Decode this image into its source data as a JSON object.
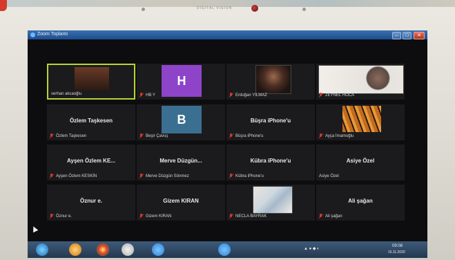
{
  "monitor": {
    "brand_text": "DIGITAL VISION"
  },
  "window": {
    "title": "Zoom Toplantı"
  },
  "tiles": [
    {
      "name": "serhan akcaoğlu",
      "center": "",
      "type": "video"
    },
    {
      "name": "HB Y",
      "center": "",
      "type": "letter",
      "letter": "H",
      "letter_color": "#8e44c8"
    },
    {
      "name": "Erdoğan YILMAZ",
      "center": "",
      "type": "video"
    },
    {
      "name": "ZEYNEL HOCA",
      "center": "",
      "type": "video"
    },
    {
      "name": "Özlem Taşkesen",
      "center": "Özlem Taşkesen",
      "type": "text"
    },
    {
      "name": "Beşir Çavuş",
      "center": "",
      "type": "letter",
      "letter": "B",
      "letter_color": "#3b6f91"
    },
    {
      "name": "Büşra iPhone'u",
      "center": "Büşra iPhone'u",
      "type": "text"
    },
    {
      "name": "Ayça İmamoğlu",
      "center": "",
      "type": "video"
    },
    {
      "name": "Ayşen Özlem KESKİN",
      "center": "Ayşen Özlem KE...",
      "type": "text"
    },
    {
      "name": "Merve Düzgün Sönmez",
      "center": "Merve Düzgün...",
      "type": "text"
    },
    {
      "name": "Kübra iPhone'u",
      "center": "Kübra iPhone'u",
      "type": "text"
    },
    {
      "name": "Asiye Özel",
      "center": "Asiye Özel",
      "type": "text"
    },
    {
      "name": "Öznur e.",
      "center": "Öznur e.",
      "type": "text"
    },
    {
      "name": "Gizem KIRAN",
      "center": "Gizem KIRAN",
      "type": "text"
    },
    {
      "name": "NECLA BAYRAK",
      "center": "",
      "type": "video"
    },
    {
      "name": "Ali şağan",
      "center": "Ali şağan",
      "type": "text"
    }
  ],
  "taskbar": {
    "clock": "09:08",
    "date": "15.11.2020"
  },
  "colors": {
    "active_border": "#b5d636",
    "muted_icon": "#d23a2a"
  }
}
